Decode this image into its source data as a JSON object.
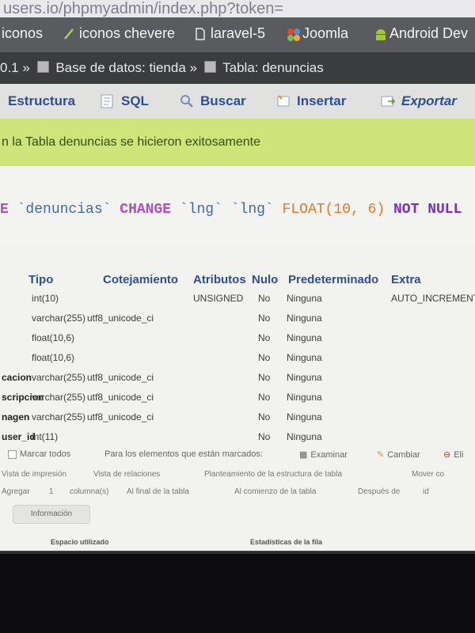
{
  "browser": {
    "url": "users.io/phpmyadmin/index.php?token=",
    "bookmarks": [
      {
        "label": "iconos",
        "icon": "iconos-bookmark-icon"
      },
      {
        "label": "iconos chevere",
        "icon": "tick-icon"
      },
      {
        "label": "laravel-5",
        "icon": "document-icon"
      },
      {
        "label": "Joomla",
        "icon": "joomla-icon"
      },
      {
        "label": "Android Dev",
        "icon": "android-icon"
      }
    ]
  },
  "breadcrumb": {
    "server": "0.1",
    "sep": "»",
    "db_label": "Base de datos: tienda",
    "table_label": "Tabla: denuncias"
  },
  "tabs": [
    {
      "label": "Estructura",
      "icon": "structure-icon"
    },
    {
      "label": "SQL",
      "icon": "sql-icon"
    },
    {
      "label": "Buscar",
      "icon": "search-icon"
    },
    {
      "label": "Insertar",
      "icon": "insert-icon"
    },
    {
      "label": "Exportar",
      "icon": "export-icon"
    }
  ],
  "success_message": "n la Tabla denuncias se hicieron exitosamente",
  "sql": {
    "kw_alter": "E",
    "table": "`denuncias`",
    "kw_change": "CHANGE",
    "col_old": "`lng`",
    "col_new": "`lng`",
    "type": "FLOAT(10, 6)",
    "kw_notnull": "NOT NULL"
  },
  "structure": {
    "headers": [
      "Tipo",
      "Cotejamiento",
      "Atributos",
      "Nulo",
      "Predeterminado",
      "Extra"
    ],
    "rows": [
      {
        "name": "",
        "type": "int(10)",
        "collation": "",
        "attributes": "UNSIGNED",
        "null": "No",
        "default": "Ninguna",
        "extra": "AUTO_INCREMENT"
      },
      {
        "name": "",
        "type": "varchar(255)",
        "collation": "utf8_unicode_ci",
        "attributes": "",
        "null": "No",
        "default": "Ninguna",
        "extra": ""
      },
      {
        "name": "",
        "type": "float(10,6)",
        "collation": "",
        "attributes": "",
        "null": "No",
        "default": "Ninguna",
        "extra": ""
      },
      {
        "name": "",
        "type": "float(10,6)",
        "collation": "",
        "attributes": "",
        "null": "No",
        "default": "Ninguna",
        "extra": ""
      },
      {
        "name": "cacion",
        "type": "varchar(255)",
        "collation": "utf8_unicode_ci",
        "attributes": "",
        "null": "No",
        "default": "Ninguna",
        "extra": ""
      },
      {
        "name": "scripcion",
        "type": "varchar(255)",
        "collation": "utf8_unicode_ci",
        "attributes": "",
        "null": "No",
        "default": "Ninguna",
        "extra": ""
      },
      {
        "name": "nagen",
        "type": "varchar(255)",
        "collation": "utf8_unicode_ci",
        "attributes": "",
        "null": "No",
        "default": "Ninguna",
        "extra": ""
      },
      {
        "name": "user_id",
        "type": "int(11)",
        "collation": "",
        "attributes": "",
        "null": "No",
        "default": "Ninguna",
        "extra": ""
      }
    ]
  },
  "bottom_toolbar": {
    "mark_all": "Marcar todos",
    "for_selected": "Para los elementos que están marcados:",
    "browse": "Examinar",
    "change": "Cambiar",
    "drop": "Eli"
  },
  "print_row": {
    "print_view": "Vista de impresión",
    "relation_view": "Vista de relaciones",
    "propose": "Planteamiento de la estructura de tabla",
    "move_columns": "Mover co"
  },
  "add_row": {
    "add": "Agregar",
    "columns": "columna(s)",
    "at_end": "Al final de la tabla",
    "at_start": "Al comienzo de la tabla",
    "after": "Después de",
    "after_col": "id"
  },
  "info_button": "Información",
  "stats": {
    "space_used": "Espacio utilizado",
    "row_stats": "Estadísticas de la fila"
  },
  "colors": {
    "link": "#2f4f8e",
    "success_bg": "#cfe47a",
    "breadcrumb_bg": "#3b3c3f",
    "sql_keyword": "#b04fc0",
    "sql_type": "#e07a28",
    "sql_notnull": "#7a2fbf"
  }
}
